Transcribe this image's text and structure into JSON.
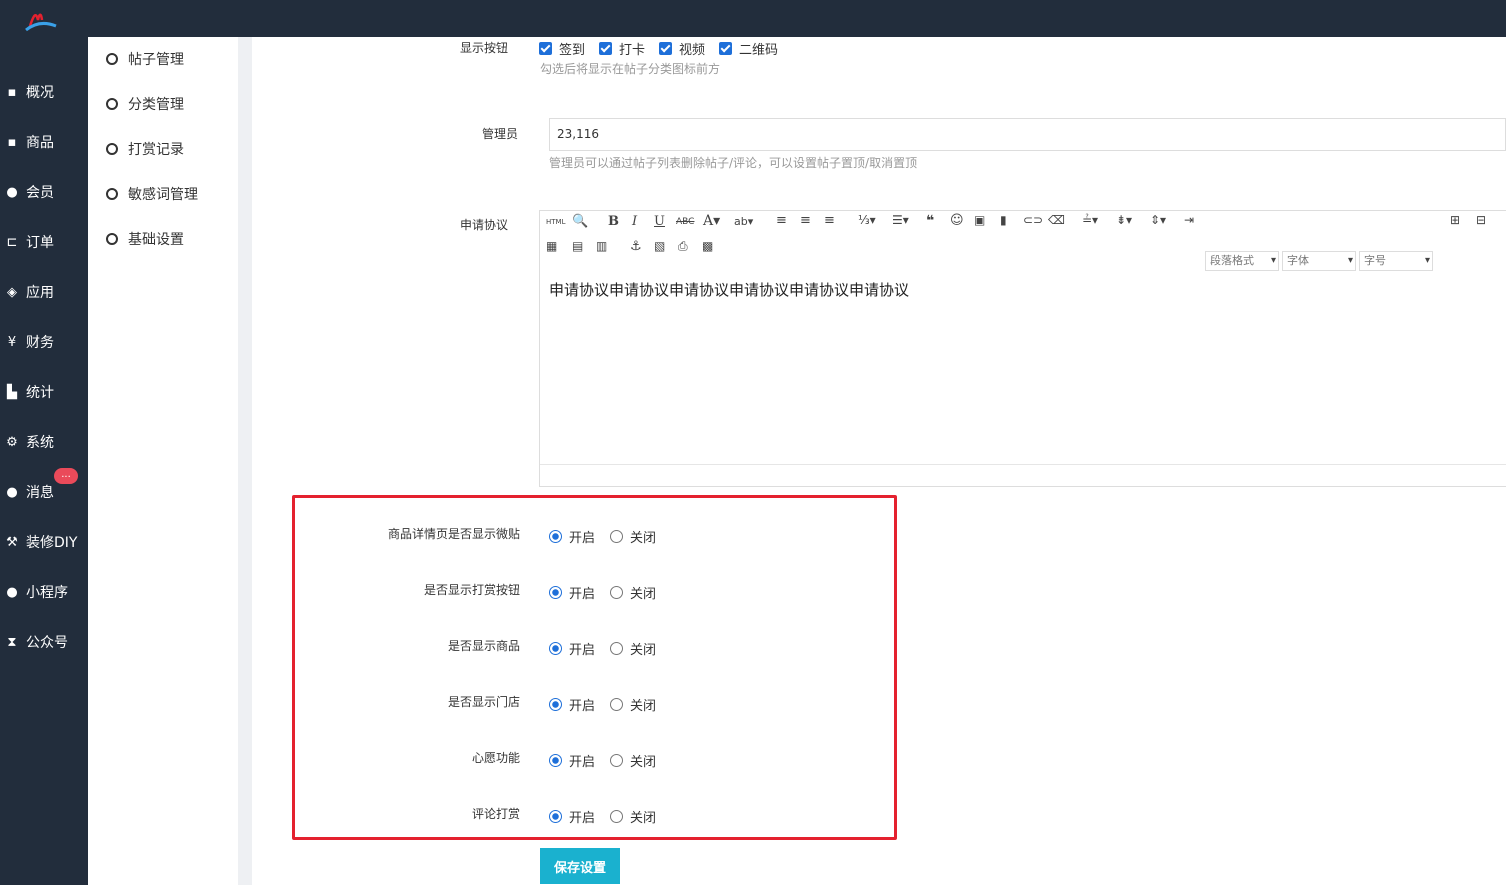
{
  "brand": {
    "logo_icon": "wave-logo-icon",
    "accent": "#1e6fd9",
    "sidebar_bg": "#222d3c"
  },
  "sidebar": {
    "items": [
      {
        "label": "概况",
        "icon": "archive-icon"
      },
      {
        "label": "商品",
        "icon": "archive-icon"
      },
      {
        "label": "会员",
        "icon": "users-icon"
      },
      {
        "label": "订单",
        "icon": "cart-icon"
      },
      {
        "label": "应用",
        "icon": "cubes-icon"
      },
      {
        "label": "财务",
        "icon": "yen-icon"
      },
      {
        "label": "统计",
        "icon": "bar-chart-icon"
      },
      {
        "label": "系统",
        "icon": "gears-icon"
      },
      {
        "label": "消息",
        "icon": "comment-icon"
      },
      {
        "label": "装修DIY",
        "icon": "gavel-icon"
      },
      {
        "label": "小程序",
        "icon": "wechat-icon"
      },
      {
        "label": "公众号",
        "icon": "hourglass-icon"
      }
    ],
    "message_badge": "..."
  },
  "subnav": {
    "items": [
      "帖子管理",
      "分类管理",
      "打赏记录",
      "敏感词管理",
      "基础设置"
    ]
  },
  "form": {
    "display_buttons": {
      "label": "显示按钮",
      "options": [
        "签到",
        "打卡",
        "视频",
        "二维码"
      ],
      "hint": "勾选后将显示在帖子分类图标前方"
    },
    "admins": {
      "label": "管理员",
      "value": "23,116",
      "hint": "管理员可以通过帖子列表删除帖子/评论，可以设置帖子置顶/取消置顶"
    },
    "agreement": {
      "label": "申请协议",
      "toolbar": {
        "paragraph": "段落格式",
        "font": "字体",
        "size": "字号",
        "html": "HTML"
      },
      "content": "申请协议申请协议申请协议申请协议申请协议申请协议"
    },
    "toggles": [
      {
        "label": "商品详情页是否显示微贴",
        "on": "开启",
        "off": "关闭"
      },
      {
        "label": "是否显示打赏按钮",
        "on": "开启",
        "off": "关闭"
      },
      {
        "label": "是否显示商品",
        "on": "开启",
        "off": "关闭"
      },
      {
        "label": "是否显示门店",
        "on": "开启",
        "off": "关闭"
      },
      {
        "label": "心愿功能",
        "on": "开启",
        "off": "关闭"
      },
      {
        "label": "评论打赏",
        "on": "开启",
        "off": "关闭"
      }
    ],
    "save_label": "保存设置"
  }
}
